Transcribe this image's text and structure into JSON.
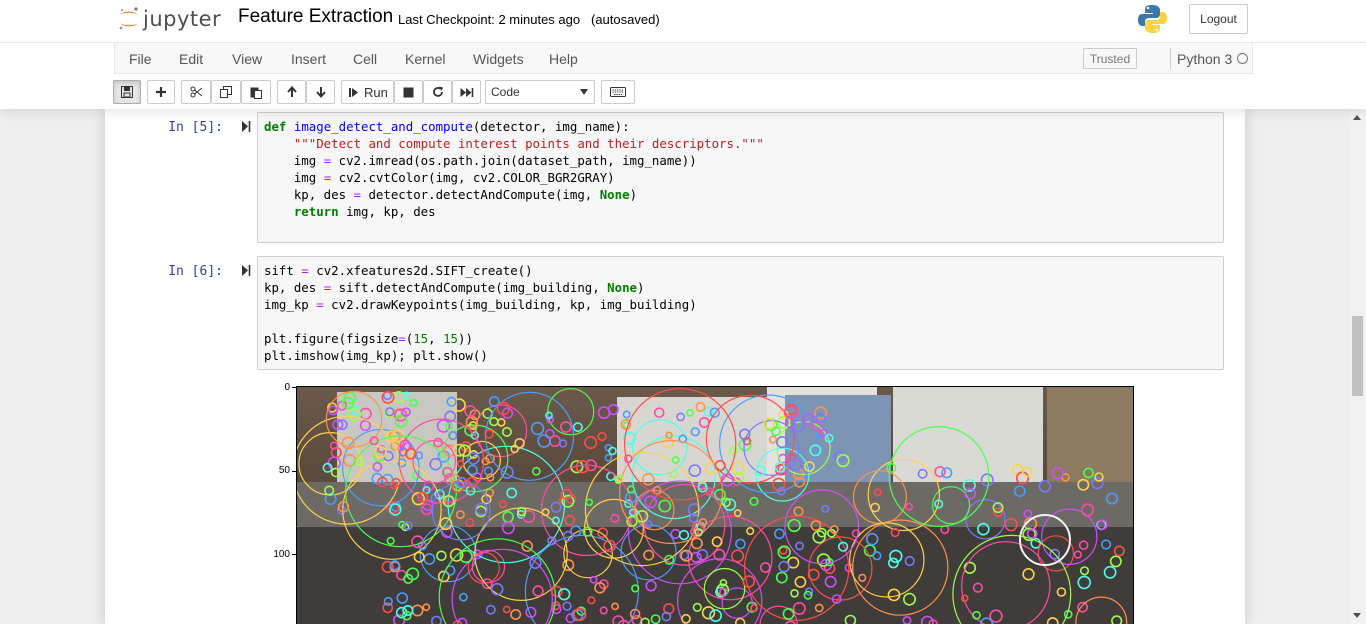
{
  "app": {
    "logo_text": "jupyter"
  },
  "notebook": {
    "name": "Feature Extraction",
    "checkpoint": "Last Checkpoint: 2 minutes ago",
    "autosave": "(autosaved)"
  },
  "header": {
    "logout_label": "Logout"
  },
  "menubar": {
    "items": [
      "File",
      "Edit",
      "View",
      "Insert",
      "Cell",
      "Kernel",
      "Widgets",
      "Help"
    ],
    "trusted": "Trusted",
    "kernel_name": "Python 3"
  },
  "toolbar": {
    "run_label": "Run",
    "cell_type": "Code",
    "buttons": [
      "save-icon",
      "plus-icon",
      "cut-icon",
      "copy-icon",
      "paste-icon",
      "arrow-up-icon",
      "arrow-down-icon",
      "run-icon",
      "stop-icon",
      "restart-icon",
      "fast-forward-icon",
      "keyboard-icon"
    ]
  },
  "cells": [
    {
      "prompt": "In [5]:",
      "lines": [
        "def image_detect_and_compute(detector, img_name):",
        "    \"\"\"Detect and compute interest points and their descriptors.\"\"\"",
        "    img = cv2.imread(os.path.join(dataset_path, img_name))",
        "    img = cv2.cvtColor(img, cv2.COLOR_BGR2GRAY)",
        "    kp, des = detector.detectAndCompute(img, None)",
        "    return img, kp, des"
      ]
    },
    {
      "prompt": "In [6]:",
      "lines": [
        "sift = cv2.xfeatures2d.SIFT_create()",
        "kp, des = sift.detectAndCompute(img_building, None)",
        "img_kp = cv2.drawKeypoints(img_building, kp, img_building)",
        "",
        "plt.figure(figsize=(15, 15))",
        "plt.imshow(img_kp); plt.show()"
      ]
    }
  ],
  "output": {
    "y_ticks": [
      "0",
      "50",
      "100"
    ]
  }
}
